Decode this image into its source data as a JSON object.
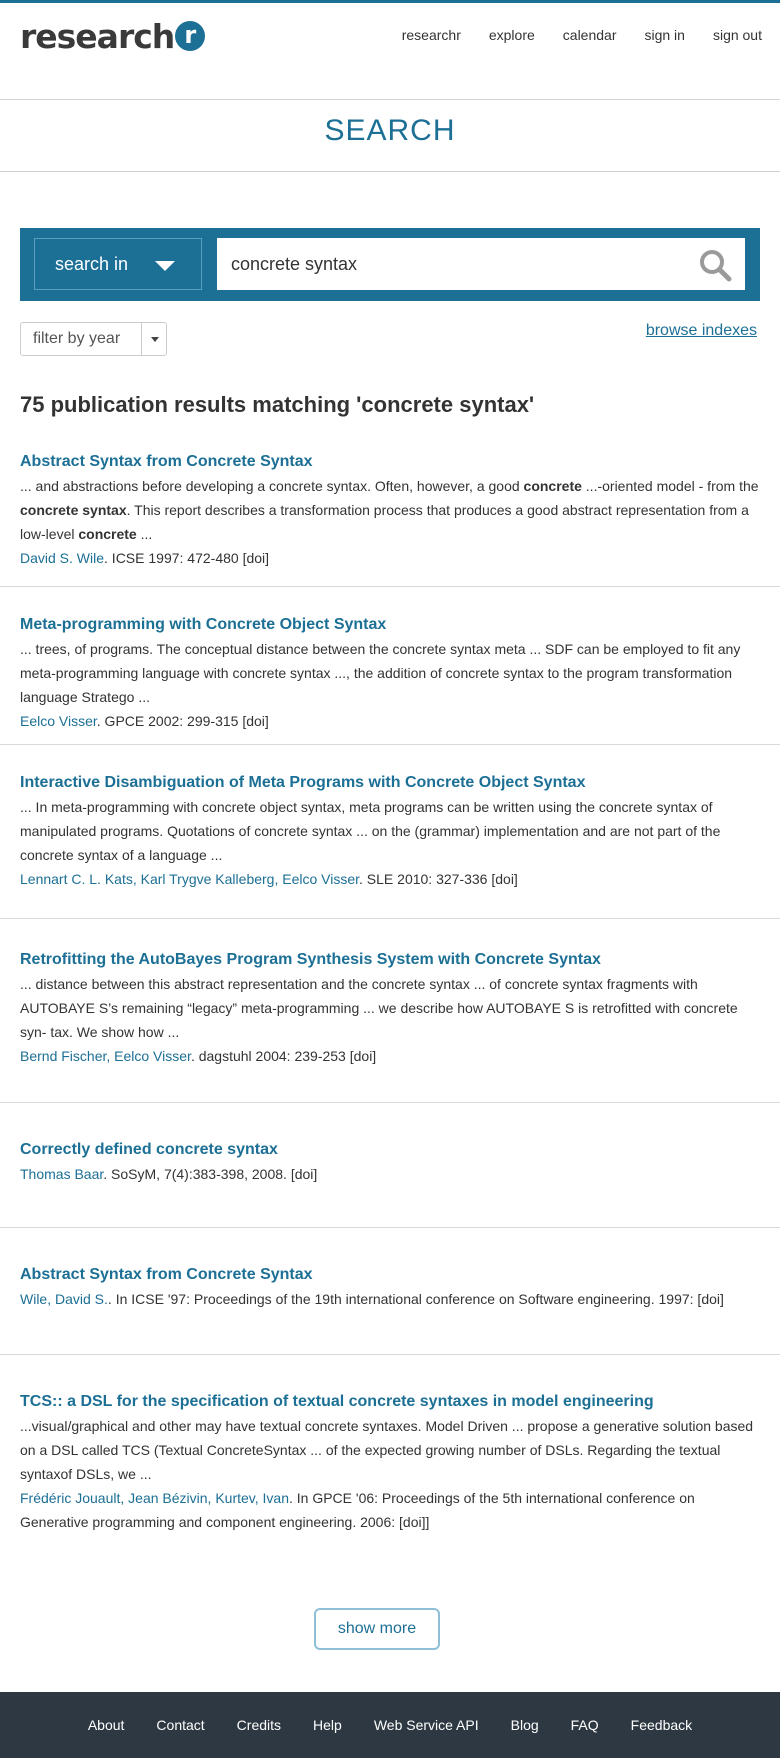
{
  "brand": {
    "text": "research",
    "r": "r"
  },
  "nav": [
    "researchr",
    "explore",
    "calendar",
    "sign in",
    "sign out"
  ],
  "page_title": "SEARCH",
  "search": {
    "scope_label": "search in",
    "query": "concrete syntax"
  },
  "filter": {
    "year_label": "filter by year"
  },
  "browse_link": "browse indexes",
  "results_heading": "75 publication results matching 'concrete syntax'",
  "results": [
    {
      "title": "Abstract Syntax from Concrete Syntax",
      "snippet_parts": [
        {
          "t": "... and abstractions before developing a concrete syntax. Often, however, a good ",
          "b": false
        },
        {
          "t": "concrete",
          "b": true
        },
        {
          "t": " ...-oriented model - from the ",
          "b": false
        },
        {
          "t": "concrete syntax",
          "b": true
        },
        {
          "t": ". This report describes a transformation process that produces a good abstract representation from a low-level ",
          "b": false
        },
        {
          "t": "concrete",
          "b": true
        },
        {
          "t": " ...",
          "b": false
        }
      ],
      "authors": "David S. Wile",
      "venue": ". ICSE 1997: 472-480 [doi]"
    },
    {
      "title": "Meta-programming with Concrete Object Syntax",
      "snippet_parts": [
        {
          "t": "... trees, of programs. The conceptual distance between the concrete syntax meta ... SDF can be employed to fit any meta-programming language with concrete syntax ..., the addition of concrete syntax to the program transformation language Stratego ...",
          "b": false
        }
      ],
      "authors": "Eelco Visser",
      "venue": ". GPCE 2002: 299-315 [doi]"
    },
    {
      "title": "Interactive Disambiguation of Meta Programs with Concrete Object Syntax",
      "snippet_parts": [
        {
          "t": "... In meta-programming with concrete object syntax, meta programs can be written using the concrete syntax of manipulated programs. Quotations of concrete syntax ... on the (grammar) implementation and are not part of the concrete syntax of a language ...",
          "b": false
        }
      ],
      "authors": "Lennart C. L. Kats, Karl Trygve Kalleberg, Eelco Visser",
      "venue": ". SLE 2010: 327-336 [doi]"
    },
    {
      "title": "Retrofitting the AutoBayes Program Synthesis System with Concrete Syntax",
      "snippet_parts": [
        {
          "t": "... distance between this abstract representation and the concrete syntax ... of concrete syntax fragments with AUTOBAYE S’s remaining “legacy” meta-programming ... we describe how AUTOBAYE S is retrofitted with concrete syn- tax. We show how ...",
          "b": false
        }
      ],
      "authors": "Bernd Fischer, Eelco Visser",
      "venue": ". dagstuhl 2004: 239-253 [doi]"
    },
    {
      "title": "Correctly defined concrete syntax",
      "snippet_parts": [],
      "authors": "Thomas Baar",
      "venue": ". SoSyM, 7(4):383-398, 2008. [doi]"
    },
    {
      "title": "Abstract Syntax from Concrete Syntax",
      "snippet_parts": [],
      "authors": "Wile, David S.",
      "venue": ". In ICSE '97: Proceedings of the 19th international conference on Software engineering. 1997: [doi]"
    },
    {
      "title": "TCS:: a DSL for the specification of textual concrete syntaxes in model engineering",
      "snippet_parts": [
        {
          "t": "...visual/graphical and other may have textual concrete syntaxes. Model Driven ... propose a generative solution based on a DSL called TCS (Textual ConcreteSyntax ... of the expected growing number of DSLs. Regarding the textual syntaxof DSLs, we ...",
          "b": false
        }
      ],
      "authors": "Frédéric Jouault, Jean Bézivin, Kurtev, Ivan",
      "venue": ". In GPCE '06: Proceedings of the 5th international conference on Generative programming and component engineering. 2006: [doi]]"
    }
  ],
  "show_more": "show more",
  "footer": [
    "About",
    "Contact",
    "Credits",
    "Help",
    "Web Service API",
    "Blog",
    "FAQ",
    "Feedback"
  ],
  "colors": {
    "accent": "#1c6f95",
    "footer_bg": "#2e3842"
  }
}
